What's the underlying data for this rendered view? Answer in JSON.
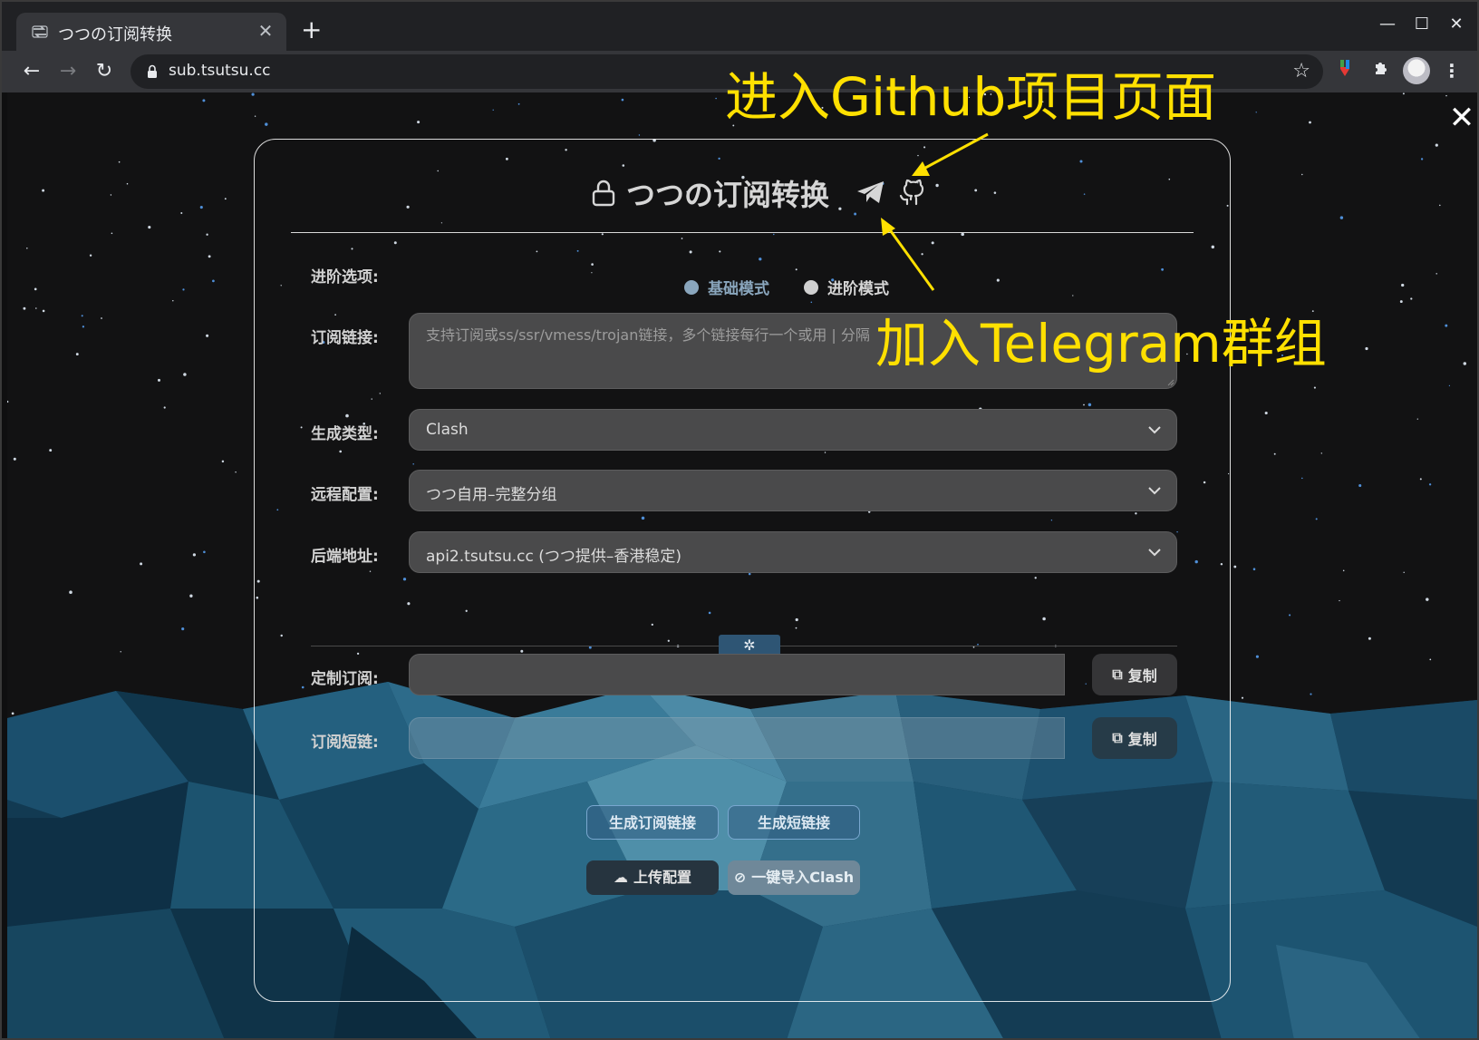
{
  "browser": {
    "tab_title": "つつの订阅转换",
    "tab_close": "✕",
    "new_tab": "+",
    "url": "sub.tsutsu.cc",
    "window_controls": {
      "minimize": "—",
      "maximize": "☐",
      "close": "✕"
    }
  },
  "page": {
    "close": "✕",
    "title": "つつの订阅转换",
    "icons": [
      "lock-icon",
      "telegram-icon",
      "github-icon"
    ]
  },
  "form": {
    "mode": {
      "label": "进阶选项:",
      "options": [
        {
          "label": "基础模式",
          "selected": true
        },
        {
          "label": "进阶模式",
          "selected": false
        }
      ]
    },
    "sub_url": {
      "label": "订阅链接:",
      "placeholder": "支持订阅或ss/ssr/vmess/trojan链接，多个链接每行一个或用 | 分隔"
    },
    "target": {
      "label": "生成类型:",
      "value": "Clash"
    },
    "remote_config": {
      "label": "远程配置:",
      "value": "つつ自用–完整分组"
    },
    "backend": {
      "label": "后端地址:",
      "value": "api2.tsutsu.cc (つつ提供–香港稳定)"
    },
    "custom_sub": {
      "label": "定制订阅:",
      "value": "",
      "copy": "复制"
    },
    "short_url": {
      "label": "订阅短链:",
      "value": "",
      "copy": "复制"
    },
    "buttons": {
      "gen_sub": "生成订阅链接",
      "gen_short": "生成短链接",
      "upload": "上传配置",
      "import_clash": "一键导入Clash"
    }
  },
  "annotations": {
    "github": "进入Github项目页面",
    "telegram": "加入Telegram群组"
  },
  "colors": {
    "annotation": "#ffe000",
    "accent": "#2e5574",
    "field": "#4a4a4b"
  }
}
